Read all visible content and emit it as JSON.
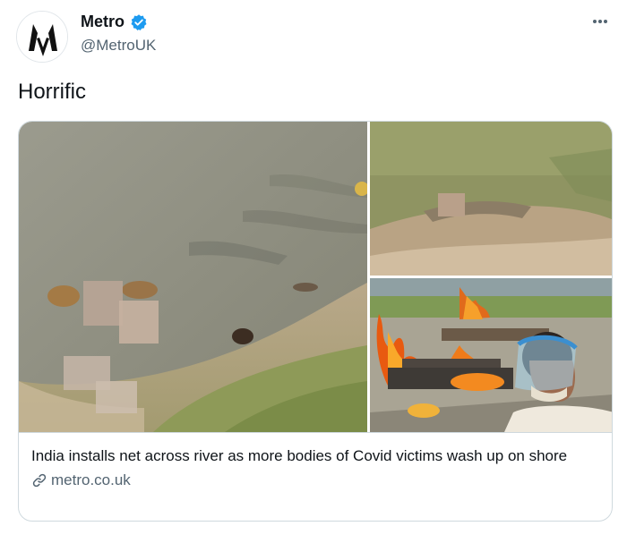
{
  "author": {
    "display_name": "Metro",
    "handle": "@MetroUK",
    "verified": true
  },
  "tweet": {
    "text": "Horrific"
  },
  "card": {
    "title": "India installs net across river as more bodies of Covid victims wash up on shore",
    "domain": "metro.co.uk",
    "images": [
      "river-bank-photo",
      "riverside-cremation-site-photo",
      "burning-pyres-photo"
    ]
  },
  "icons": {
    "verified": "verified-badge-icon",
    "more": "more-options-icon",
    "link": "link-icon"
  },
  "colors": {
    "verified_blue": "#1d9bf0",
    "secondary_text": "#536471",
    "border": "#cfd9de"
  }
}
